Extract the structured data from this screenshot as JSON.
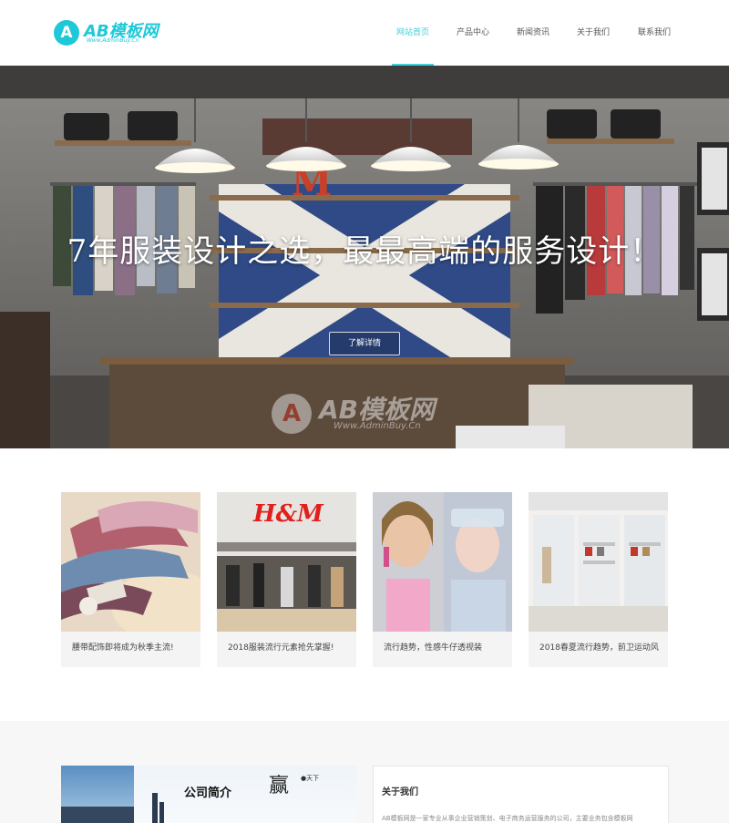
{
  "brand": {
    "logo_letter": "A",
    "logo_text": "AB模板网",
    "logo_sub": "Www.AdminBuy.Cn",
    "accent_color": "#1fc8d8"
  },
  "nav": {
    "items": [
      {
        "label": "网站首页",
        "active": true
      },
      {
        "label": "产品中心",
        "active": false
      },
      {
        "label": "新闻资讯",
        "active": false
      },
      {
        "label": "关于我们",
        "active": false
      },
      {
        "label": "联系我们",
        "active": false
      }
    ]
  },
  "banner": {
    "title": "7年服装设计之选，最最高端的服务设计！",
    "button_label": "了解详情",
    "watermark_letter": "A",
    "watermark_text": "AB模板网",
    "watermark_sub": "Www.AdminBuy.Cn"
  },
  "products": [
    {
      "title": "腰带配饰即将成为秋季主流!"
    },
    {
      "title": "2018服装流行元素抢先掌握!"
    },
    {
      "title": "流行趋势，性感牛仔透视装"
    },
    {
      "title": "2018春夏流行趋势，前卫运动风"
    }
  ],
  "about": {
    "image_caption": "公司简介",
    "image_brush": "赢",
    "image_small": "●天下",
    "title": "关于我们",
    "text": "AB模板网是一家专业从事企业营销策划、电子商务运营服务的公司，主要业务包含模板网"
  }
}
